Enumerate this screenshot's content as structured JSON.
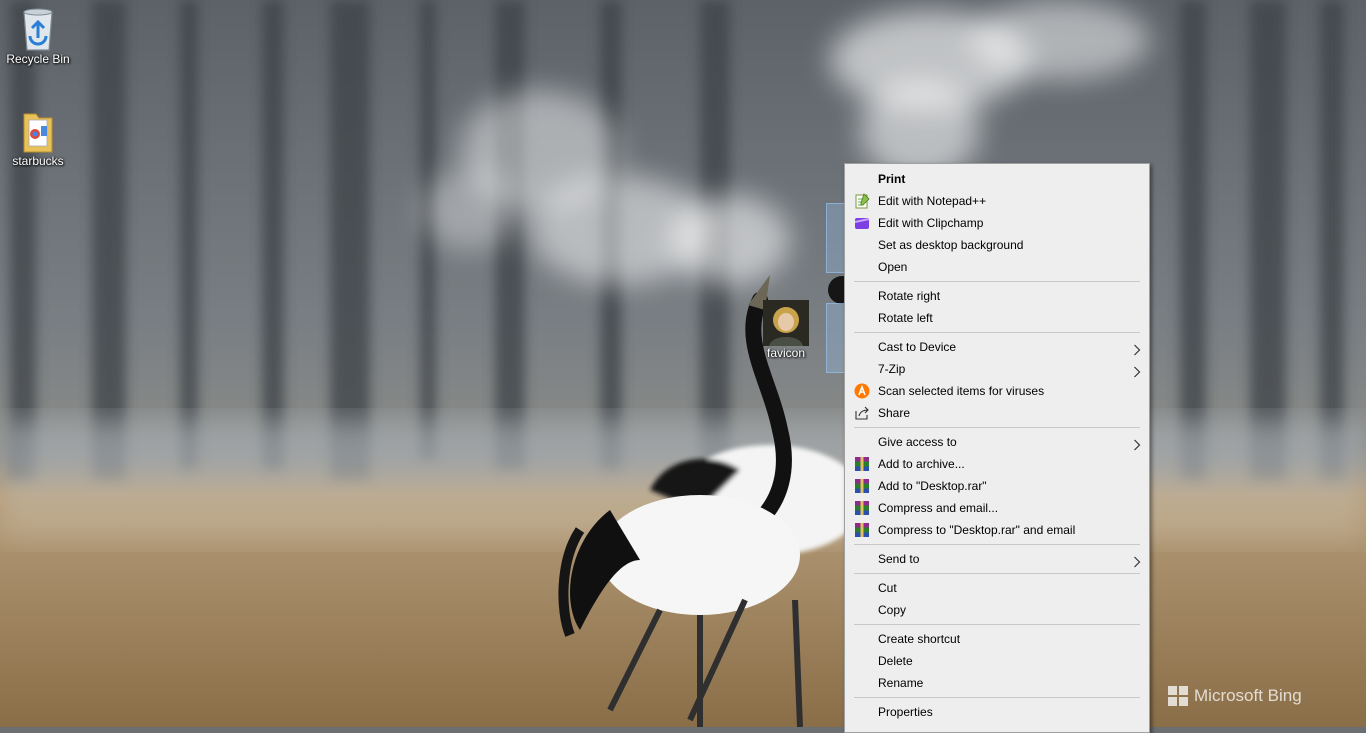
{
  "desktop": {
    "icons": [
      {
        "label": "Recycle Bin",
        "icon": "recycle-bin-icon"
      },
      {
        "label": "starbucks",
        "icon": "folder-icon"
      },
      {
        "label": "favicon",
        "icon": "image-thumbnail-icon"
      }
    ],
    "watermark": "Microsoft Bing"
  },
  "context_menu": {
    "groups": [
      [
        {
          "label": "Print",
          "bold": true
        },
        {
          "label": "Edit with Notepad++",
          "icon": "notepad-plus-plus-icon"
        },
        {
          "label": "Edit with Clipchamp",
          "icon": "clipchamp-icon"
        },
        {
          "label": "Set as desktop background"
        },
        {
          "label": "Open"
        }
      ],
      [
        {
          "label": "Rotate right"
        },
        {
          "label": "Rotate left"
        }
      ],
      [
        {
          "label": "Cast to Device",
          "submenu": true
        },
        {
          "label": "7-Zip",
          "submenu": true
        },
        {
          "label": "Scan selected items for viruses",
          "icon": "avast-icon"
        },
        {
          "label": "Share",
          "icon": "share-icon"
        }
      ],
      [
        {
          "label": "Give access to",
          "submenu": true
        },
        {
          "label": "Add to archive...",
          "icon": "winrar-icon"
        },
        {
          "label": "Add to \"Desktop.rar\"",
          "icon": "winrar-icon"
        },
        {
          "label": "Compress and email...",
          "icon": "winrar-icon"
        },
        {
          "label": "Compress to \"Desktop.rar\" and email",
          "icon": "winrar-icon"
        }
      ],
      [
        {
          "label": "Send to",
          "submenu": true
        }
      ],
      [
        {
          "label": "Cut"
        },
        {
          "label": "Copy"
        }
      ],
      [
        {
          "label": "Create shortcut"
        },
        {
          "label": "Delete"
        },
        {
          "label": "Rename"
        }
      ],
      [
        {
          "label": "Properties"
        }
      ]
    ]
  },
  "colors": {
    "menu_bg": "#eeeeee",
    "separator": "#c8c8c8",
    "selection": "#99ccff"
  }
}
